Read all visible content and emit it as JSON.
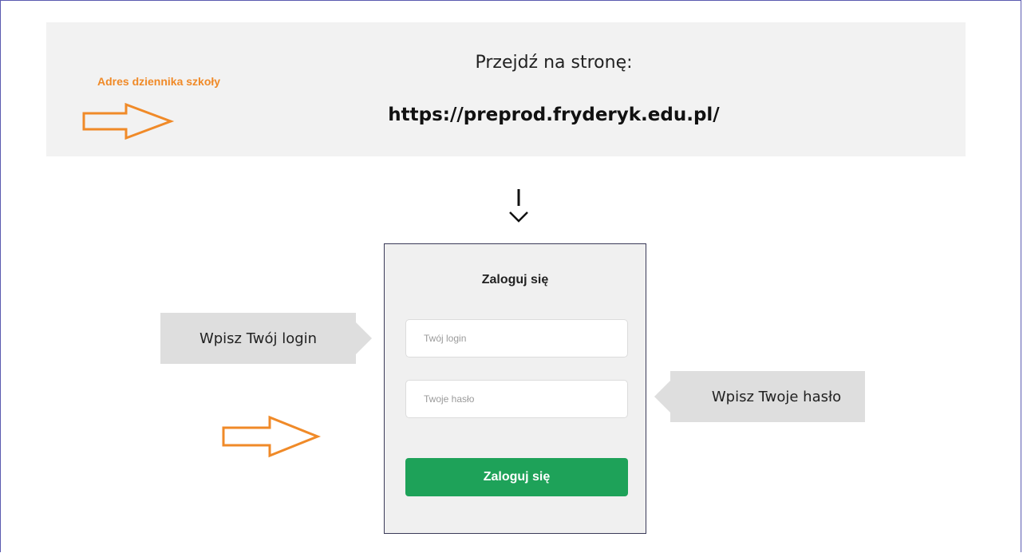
{
  "banner": {
    "heading": "Przejdź na stronę:",
    "url": "https://preprod.fryderyk.edu.pl/"
  },
  "annotation": {
    "school_address_label": "Adres dziennika szkoły",
    "accent_color": "#f08a28"
  },
  "login_panel": {
    "title": "Zaloguj się",
    "login_placeholder": "Twój login",
    "password_placeholder": "Twoje hasło",
    "submit_label": "Zaloguj się",
    "submit_color": "#1ea259"
  },
  "callouts": {
    "login_hint": "Wpisz Twój login",
    "password_hint": "Wpisz Twoje hasło"
  },
  "icons": {
    "flow_arrow": "down-arrow-icon",
    "pointer_arrow": "right-arrow-outline-icon"
  }
}
